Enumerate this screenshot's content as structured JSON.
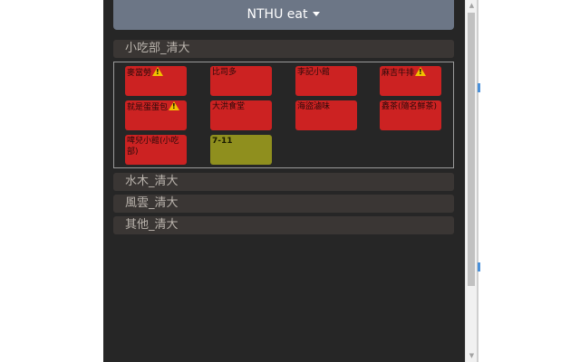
{
  "header": {
    "title": "NTHU eat"
  },
  "categories": [
    {
      "label": "小吃部_清大"
    },
    {
      "label": "水木_清大"
    },
    {
      "label": "風雲_清大"
    },
    {
      "label": "其他_清大"
    }
  ],
  "shops": [
    {
      "name": "麥當勞",
      "warning": true,
      "color": "#cc2222"
    },
    {
      "name": "比司多",
      "warning": false,
      "color": "#cc2222"
    },
    {
      "name": "李記小館",
      "warning": false,
      "color": "#cc2222"
    },
    {
      "name": "麻吉牛排",
      "warning": true,
      "color": "#cc2222"
    },
    {
      "name": "就是蛋蛋包",
      "warning": true,
      "color": "#cc2222"
    },
    {
      "name": "大洪食堂",
      "warning": false,
      "color": "#cc2222"
    },
    {
      "name": "海盜滷味",
      "warning": false,
      "color": "#cc2222"
    },
    {
      "name": "鑫茶(隨名鮮茶)",
      "warning": false,
      "color": "#cc2222"
    },
    {
      "name": "啤兒小館(小吃部)",
      "warning": false,
      "color": "#cc2222"
    },
    {
      "name": "7-11",
      "warning": false,
      "color": "#8f8f1e"
    }
  ],
  "icons": {
    "warning": "warning-icon",
    "dropdown": "caret-down-icon"
  }
}
